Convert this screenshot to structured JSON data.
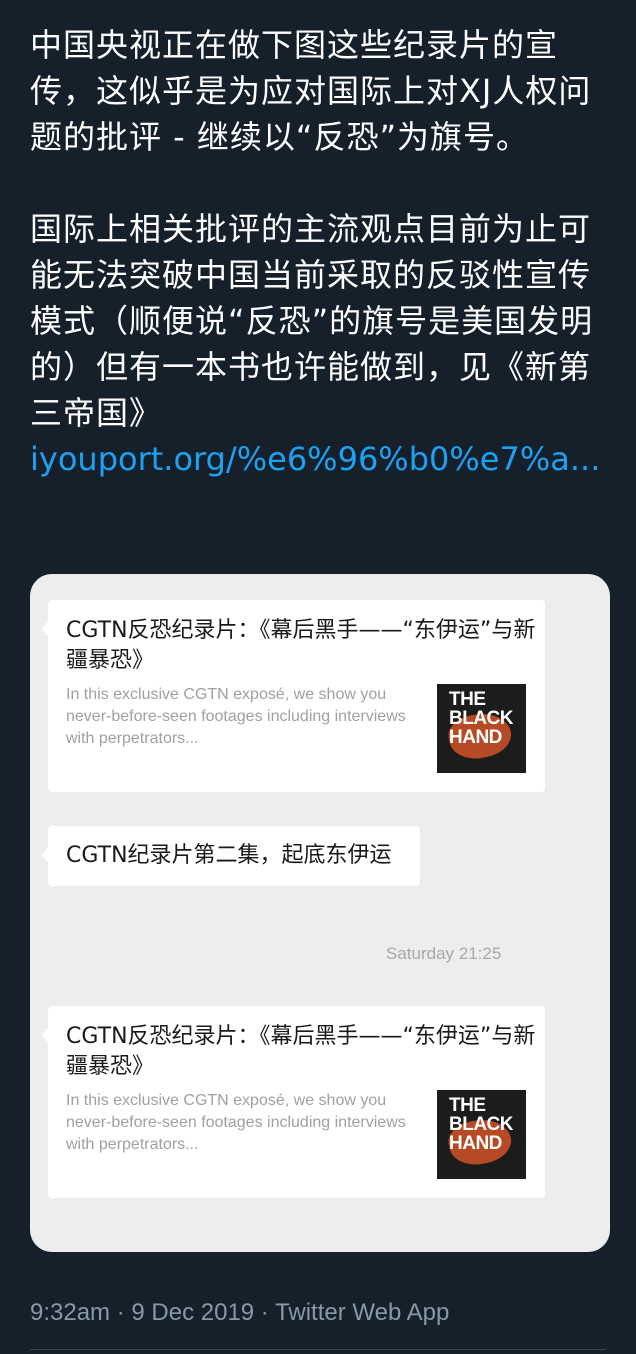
{
  "tweet": {
    "paragraph1": "中国央视正在做下图这些纪录片的宣传，这似乎是为应对国际上对XJ人权问题的批评 - 继续以“反恐”为旗号。",
    "paragraph2": "国际上相关批评的主流观点目前为止可能无法突破中国当前采取的反驳性宣传模式（顺便说“反恐”的旗号是美国发明的）但有一本书也许能做到，见《新第三帝国》",
    "link_text": "iyouport.org/%e6%96%b0%e7%a..."
  },
  "media": {
    "messages": [
      {
        "title": "CGTN反恐纪录片：《幕后黑手——“东伊运”与新疆暴恐》",
        "description": "In this exclusive CGTN exposé, we show you never-before-seen footages including interviews with perpetrators...",
        "thumbnail_text": "THE BLACK HAND"
      },
      {
        "text": "CGTN纪录片第二集，起底东伊运"
      },
      {
        "title": "CGTN反恐纪录片：《幕后黑手——“东伊运”与新疆暴恐》",
        "description": "In this exclusive CGTN exposé, we show you never-before-seen footages including interviews with perpetrators...",
        "thumbnail_text": "THE BLACK HAND"
      }
    ],
    "timestamp": "Saturday 21:25"
  },
  "meta": {
    "text": "9:32am · 9 Dec 2019 · Twitter Web App"
  },
  "colors": {
    "background": "#15202b",
    "link": "#1da1f2",
    "meta_text": "#8899a6",
    "thumbnail_accent": "#b64a24"
  }
}
